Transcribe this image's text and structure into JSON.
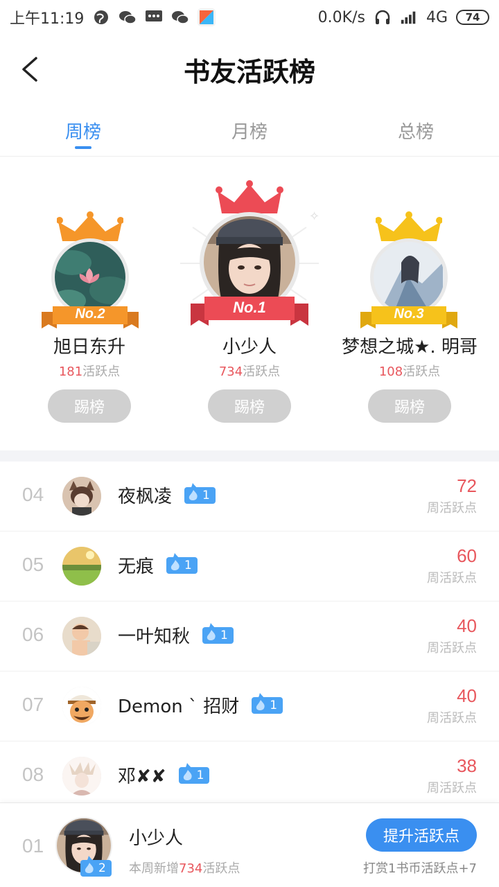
{
  "status_bar": {
    "time": "上午11:19",
    "net_speed": "0.0K/s",
    "network": "4G",
    "battery": "74"
  },
  "header": {
    "title": "书友活跃榜"
  },
  "tabs": [
    {
      "label": "周榜",
      "active": true
    },
    {
      "label": "月榜",
      "active": false
    },
    {
      "label": "总榜",
      "active": false
    }
  ],
  "podium": {
    "first": {
      "rank_label": "No.1",
      "name": "小少人",
      "score": "734",
      "unit": "活跃点",
      "button": "踢榜"
    },
    "second": {
      "rank_label": "No.2",
      "name": "旭日东升",
      "score": "181",
      "unit": "活跃点",
      "button": "踢榜"
    },
    "third": {
      "rank_label": "No.3",
      "name": "梦想之城★. 明哥",
      "score": "108",
      "unit": "活跃点",
      "button": "踢榜"
    }
  },
  "list": [
    {
      "rank": "04",
      "name": "夜枫凌",
      "level": "1",
      "score": "72",
      "unit": "周活跃点"
    },
    {
      "rank": "05",
      "name": "无痕",
      "level": "1",
      "score": "60",
      "unit": "周活跃点"
    },
    {
      "rank": "06",
      "name": "一叶知秋",
      "level": "1",
      "score": "40",
      "unit": "周活跃点"
    },
    {
      "rank": "07",
      "name": "Demon ` 招财",
      "level": "1",
      "score": "40",
      "unit": "周活跃点"
    },
    {
      "rank": "08",
      "name": "邓✘✘",
      "level": "1",
      "score": "38",
      "unit": "周活跃点"
    }
  ],
  "footer": {
    "rank": "01",
    "name": "小少人",
    "level": "2",
    "sub_prefix": "本周新增",
    "sub_value": "734",
    "sub_suffix": "活跃点",
    "button": "提升活跃点",
    "hint": "打赏1书币活跃点+7"
  },
  "colors": {
    "accent": "#3a8ff0",
    "score": "#e8575d",
    "gold": "#f5a623",
    "red_ribbon": "#ec4b55",
    "orange_ribbon": "#f5962a"
  }
}
